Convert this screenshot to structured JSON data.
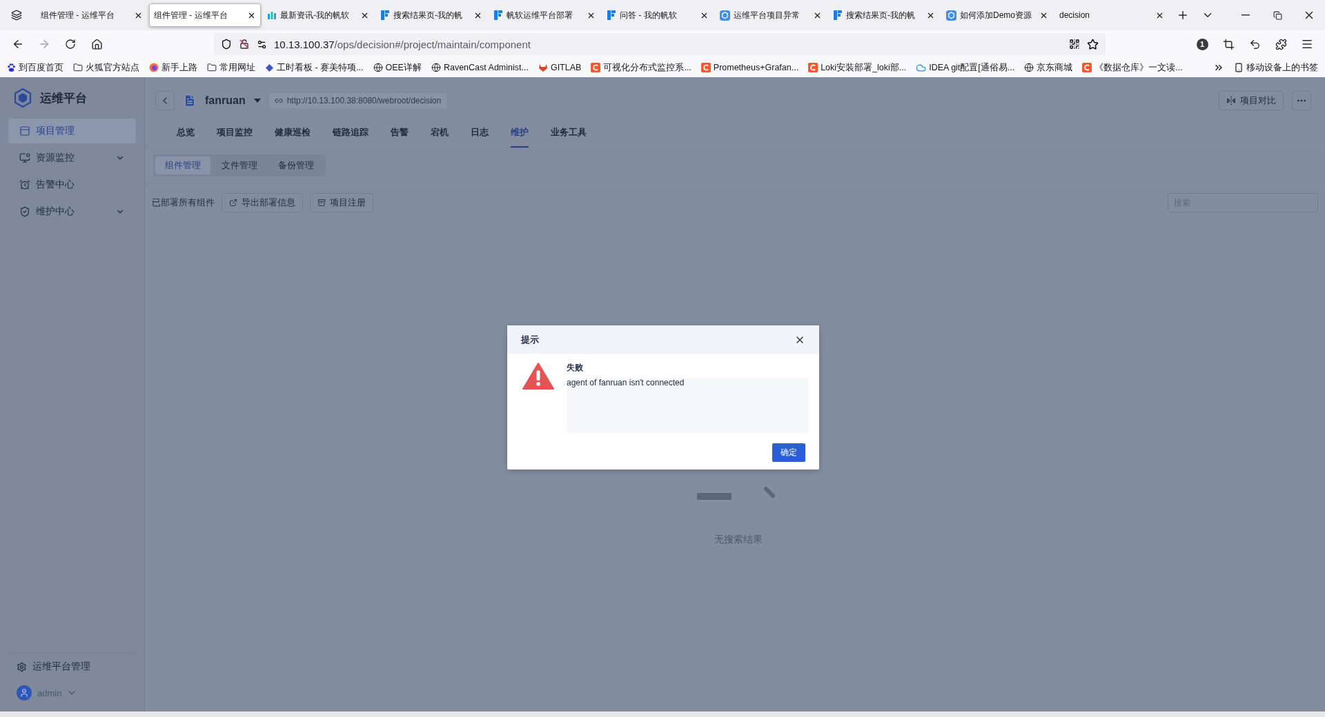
{
  "browser": {
    "tabs": [
      {
        "title": "组件管理 - 运维平台",
        "selected": false
      },
      {
        "title": "组件管理 - 运维平台",
        "selected": true
      },
      {
        "title": "最新资讯-我的帆软",
        "selected": false
      },
      {
        "title": "搜索结果页-我的帆",
        "selected": false
      },
      {
        "title": "帆软运维平台部署",
        "selected": false
      },
      {
        "title": "问答 - 我的帆软",
        "selected": false
      },
      {
        "title": "运维平台项目异常",
        "selected": false
      },
      {
        "title": "搜索结果页-我的帆",
        "selected": false
      },
      {
        "title": "如何添加Demo资源",
        "selected": false
      },
      {
        "title": "decision",
        "selected": false
      }
    ],
    "address": {
      "host": "10.13.100.37",
      "path": "/ops/decision#/project/maintain/component"
    },
    "extension_badge": "1",
    "bookmarks": [
      "到百度首页",
      "火狐官方站点",
      "新手上路",
      "常用网址",
      "工时看板 - 赛美特项...",
      "OEE详解",
      "RavenCast Administ...",
      "GITLAB",
      "可视化分布式监控系...",
      "Prometheus+Grafan...",
      "Loki安装部署_loki部...",
      "IDEA git配置[通俗易...",
      "京东商城",
      "《数据仓库》一文读..."
    ],
    "mobile_bookmarks": "移动设备上的书签"
  },
  "app": {
    "brand": "运维平台",
    "sidebar": {
      "items": [
        {
          "label": "项目管理",
          "selected": true
        },
        {
          "label": "资源监控",
          "selected": false
        },
        {
          "label": "告警中心",
          "selected": false
        },
        {
          "label": "维护中心",
          "selected": false
        }
      ],
      "settings": "运维平台管理",
      "user": "admin"
    },
    "project": {
      "name": "fanruan",
      "url": "http://10.13.100.38:8080/webroot/decision",
      "compare_button": "项目对比"
    },
    "nav_tabs": [
      {
        "label": "总览",
        "selected": false
      },
      {
        "label": "项目监控",
        "selected": false
      },
      {
        "label": "健康巡检",
        "selected": false
      },
      {
        "label": "链路追踪",
        "selected": false
      },
      {
        "label": "告警",
        "selected": false
      },
      {
        "label": "宕机",
        "selected": false
      },
      {
        "label": "日志",
        "selected": false
      },
      {
        "label": "维护",
        "selected": true
      },
      {
        "label": "业务工具",
        "selected": false
      }
    ],
    "sub_tabs": [
      {
        "label": "组件管理",
        "selected": true
      },
      {
        "label": "文件管理",
        "selected": false
      },
      {
        "label": "备份管理",
        "selected": false
      }
    ],
    "toolbar": {
      "label": "已部署所有组件",
      "buttons": [
        "导出部署信息",
        "项目注册"
      ],
      "search": {
        "placeholder": "搜索"
      }
    },
    "empty_state": "无搜索结果"
  },
  "dialog": {
    "title": "提示",
    "heading": "失败",
    "message": "agent of fanruan isn't connected",
    "confirm": "确定"
  }
}
